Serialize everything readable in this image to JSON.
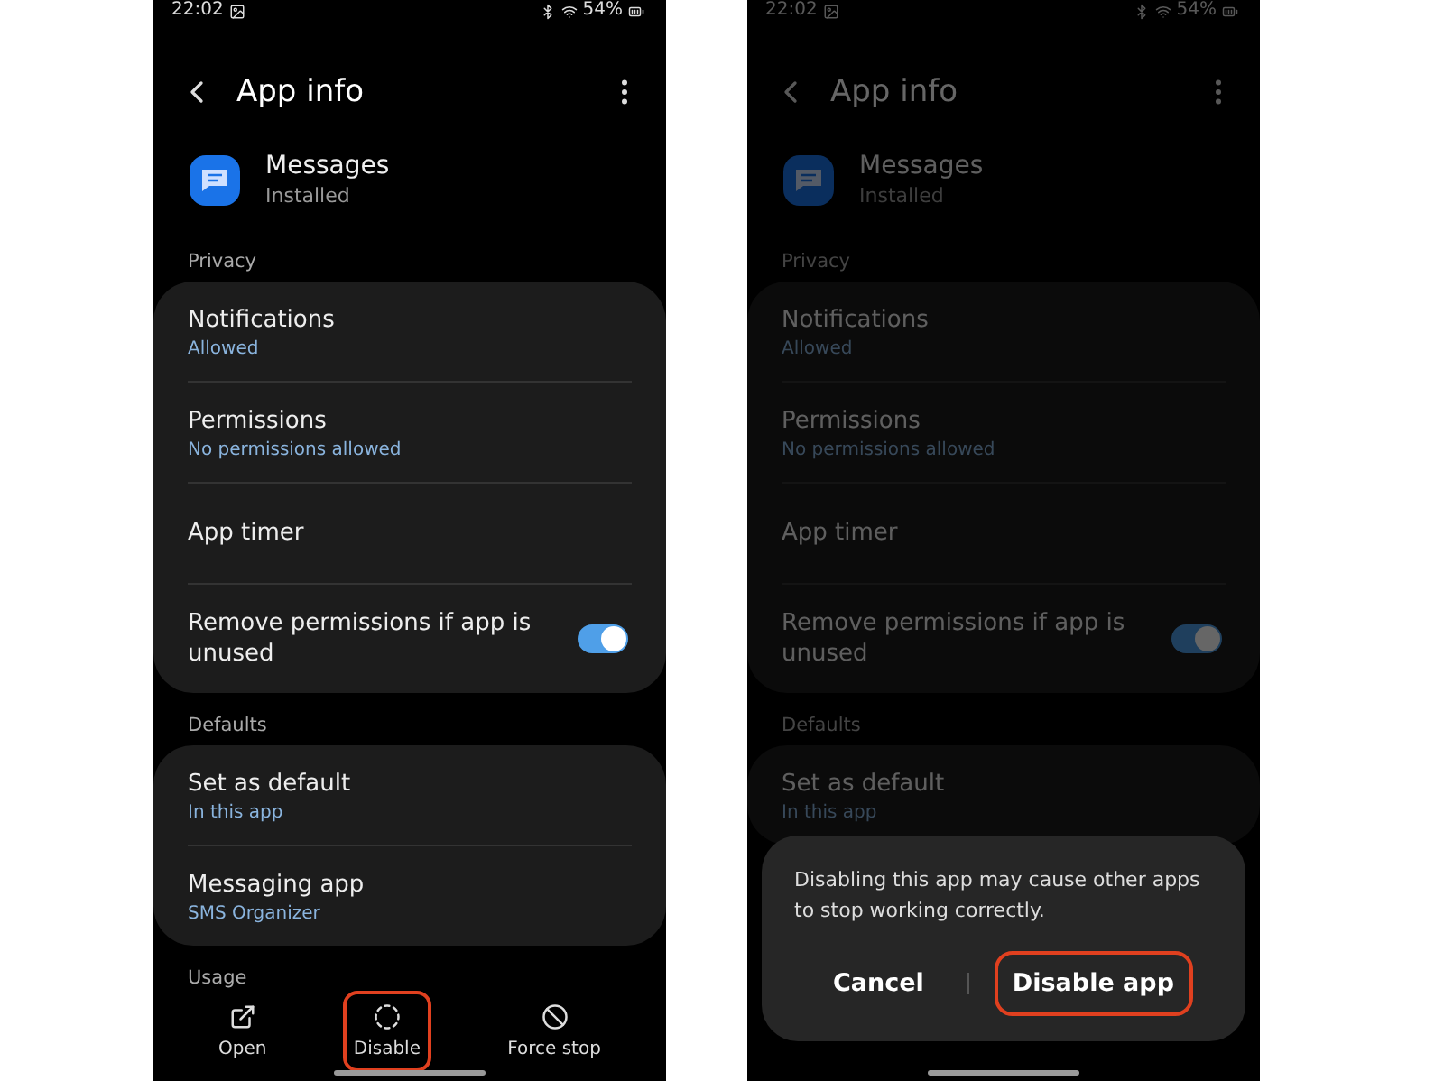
{
  "phones": [
    {
      "dimmed": false,
      "status_bar": {
        "time": "22:02",
        "battery": "54%"
      },
      "header": {
        "title": "App info"
      },
      "app": {
        "name": "Messages",
        "status": "Installed"
      },
      "sections": [
        {
          "label": "Privacy",
          "items": [
            {
              "kind": "link",
              "title": "Notifications",
              "subtitle": "Allowed"
            },
            {
              "kind": "link",
              "title": "Permissions",
              "subtitle": "No permissions allowed"
            },
            {
              "kind": "link",
              "title": "App timer"
            },
            {
              "kind": "toggle",
              "title": "Remove permissions if app is unused",
              "on": true
            }
          ]
        },
        {
          "label": "Defaults",
          "items": [
            {
              "kind": "link",
              "title": "Set as default",
              "subtitle": "In this app"
            },
            {
              "kind": "link",
              "title": "Messaging app",
              "subtitle": "SMS Organizer"
            }
          ]
        },
        {
          "label": "Usage"
        }
      ],
      "actions": [
        {
          "kind": "open",
          "label": "Open",
          "highlighted": false
        },
        {
          "kind": "disable",
          "label": "Disable",
          "highlighted": true
        },
        {
          "kind": "force_stop",
          "label": "Force stop",
          "highlighted": false
        }
      ]
    },
    {
      "dimmed": true,
      "status_bar": {
        "time": "22:02",
        "battery": "54%"
      },
      "header": {
        "title": "App info"
      },
      "app": {
        "name": "Messages",
        "status": "Installed"
      },
      "sections": [
        {
          "label": "Privacy",
          "items": [
            {
              "kind": "link",
              "title": "Notifications",
              "subtitle": "Allowed"
            },
            {
              "kind": "link",
              "title": "Permissions",
              "subtitle": "No permissions allowed"
            },
            {
              "kind": "link",
              "title": "App timer"
            },
            {
              "kind": "toggle",
              "title": "Remove permissions if app is unused",
              "on": true
            }
          ]
        },
        {
          "label": "Defaults",
          "items": [
            {
              "kind": "link",
              "title": "Set as default",
              "subtitle": "In this app"
            }
          ]
        }
      ],
      "dialog": {
        "message": "Disabling this app may cause other apps to stop working correctly.",
        "buttons": [
          {
            "label": "Cancel",
            "highlighted": false
          },
          {
            "label": "Disable app",
            "highlighted": true
          }
        ]
      }
    }
  ]
}
